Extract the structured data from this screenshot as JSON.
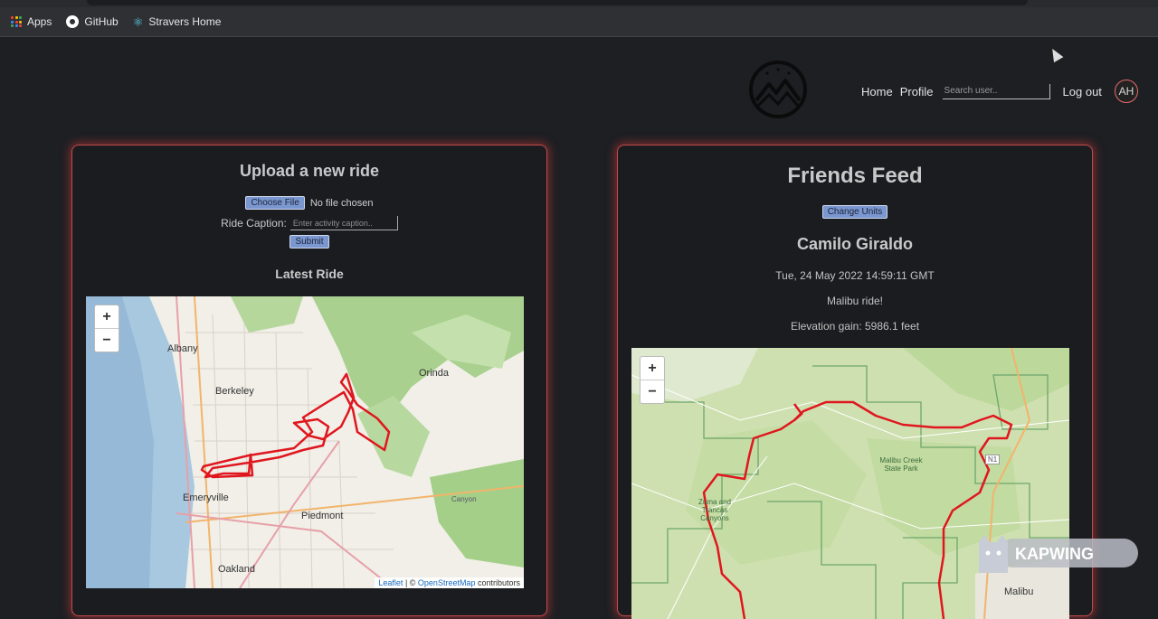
{
  "bookmarks": [
    {
      "label": "Apps",
      "icon": "apps-grid-icon"
    },
    {
      "label": "GitHub",
      "icon": "github-icon"
    },
    {
      "label": "Stravers Home",
      "icon": "react-icon"
    }
  ],
  "nav": {
    "home": "Home",
    "profile": "Profile",
    "search_placeholder": "Search user..",
    "logout": "Log out",
    "avatar_initials": "AH"
  },
  "upload": {
    "title": "Upload a new ride",
    "choose_file": "Choose File",
    "no_file": "No file chosen",
    "caption_label": "Ride Caption:",
    "caption_placeholder": "Enter activity caption..",
    "submit": "Submit",
    "latest_title": "Latest Ride"
  },
  "map1": {
    "labels": [
      "Albany",
      "Berkeley",
      "Orinda",
      "Emeryville",
      "Piedmont",
      "Oakland",
      "Canyon"
    ],
    "zoom_in": "+",
    "zoom_out": "−",
    "attribution_leaflet": "Leaflet",
    "attribution_sep": " | © ",
    "attribution_osm": "OpenStreetMap",
    "attribution_tail": " contributors"
  },
  "feed": {
    "title": "Friends Feed",
    "change_units": "Change Units",
    "name": "Camilo Giraldo",
    "date": "Tue, 24 May 2022 14:59:11 GMT",
    "caption": "Malibu ride!",
    "elevation": "Elevation gain: 5986.1 feet"
  },
  "map2": {
    "labels": [
      "Malibu Creek State Park",
      "Zuma and Trancas Canyons",
      "Malibu",
      "N1"
    ],
    "zoom_in": "+",
    "zoom_out": "−"
  },
  "watermark": "KAPWING",
  "colors": {
    "accent_glow": "#c24a4a",
    "button": "#7a97d0",
    "route": "#e0161e"
  }
}
